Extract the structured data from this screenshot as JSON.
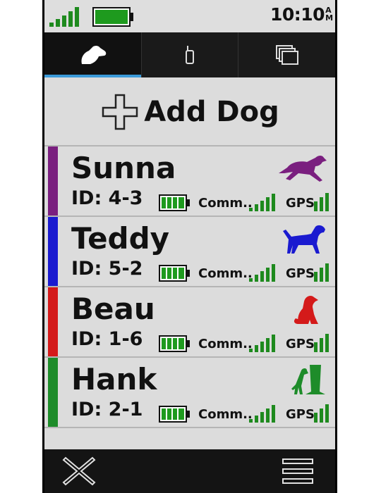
{
  "status": {
    "time": "10:10",
    "ampm": "AM",
    "signal_icon": "cell-signal-icon",
    "battery_icon": "battery-full-icon",
    "battery_color": "#1e9a1e"
  },
  "tabs": [
    {
      "icon": "dog-icon",
      "active": true
    },
    {
      "icon": "handheld-device-icon",
      "active": false
    },
    {
      "icon": "pages-icon",
      "active": false
    }
  ],
  "accent": "#3b9ad9",
  "add_dog": {
    "icon": "plus-icon",
    "label": "Add Dog"
  },
  "dogs": [
    {
      "name": "Sunna",
      "id": "ID: 4-3",
      "color": "#7a1f7f",
      "pose": "running",
      "comm_label": "Comm..",
      "gps_label": "GPS"
    },
    {
      "name": "Teddy",
      "id": "ID: 5-2",
      "color": "#1a1ad0",
      "pose": "pointing",
      "comm_label": "Comm..",
      "gps_label": "GPS"
    },
    {
      "name": "Beau",
      "id": "ID: 1-6",
      "color": "#d41a1a",
      "pose": "sitting",
      "comm_label": "Comm..",
      "gps_label": "GPS"
    },
    {
      "name": "Hank",
      "id": "ID: 2-1",
      "color": "#1e8c2a",
      "pose": "treed",
      "comm_label": "Comm..",
      "gps_label": "GPS"
    }
  ],
  "bottom": {
    "close_icon": "close-icon",
    "menu_icon": "menu-icon"
  }
}
